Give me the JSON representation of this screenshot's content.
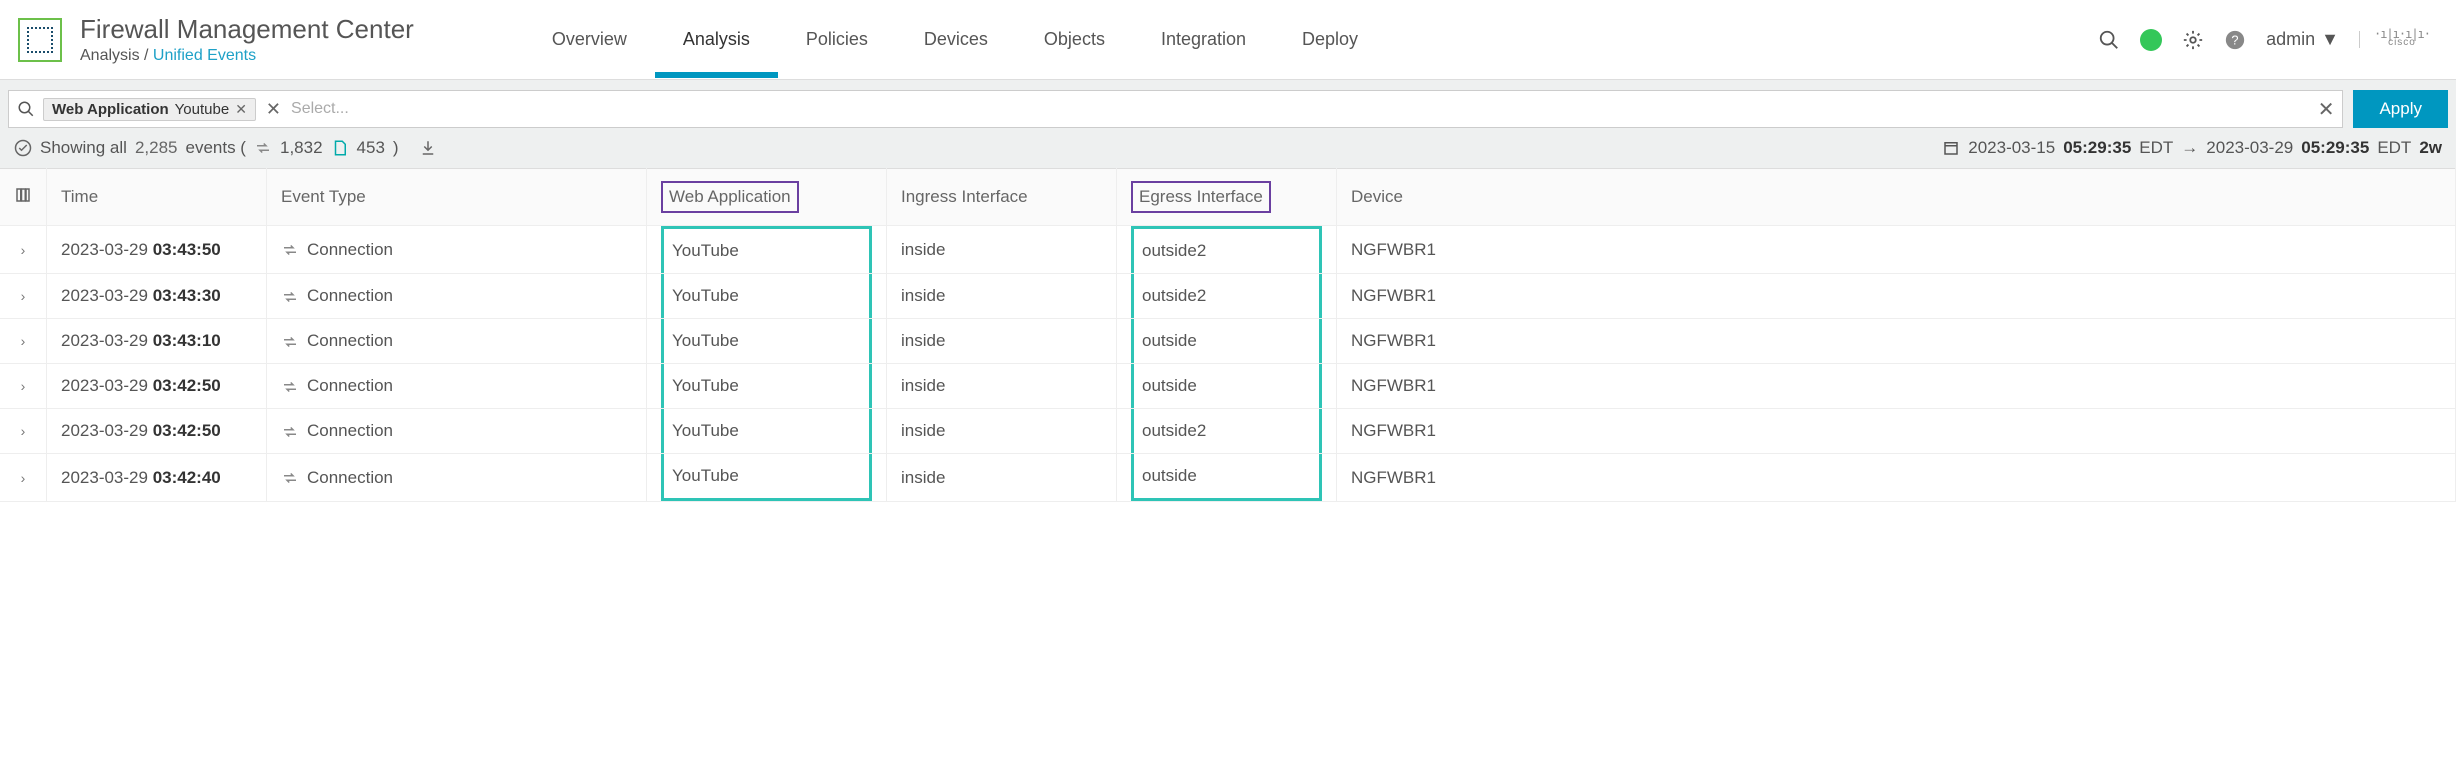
{
  "header": {
    "app_title": "Firewall Management Center",
    "breadcrumb_section": "Analysis",
    "breadcrumb_separator": " / ",
    "breadcrumb_page": "Unified Events",
    "nav": [
      "Overview",
      "Analysis",
      "Policies",
      "Devices",
      "Objects",
      "Integration",
      "Deploy"
    ],
    "active_nav_index": 1,
    "user_label": "admin",
    "vendor": "cisco"
  },
  "filter": {
    "chip_name": "Web Application",
    "chip_value": "Youtube",
    "placeholder": "Select...",
    "apply_label": "Apply"
  },
  "status": {
    "prefix": "Showing all ",
    "total_events": "2,285",
    "events_word": " events (",
    "count_a": "1,832",
    "count_b": "453",
    "close_paren": ")",
    "range_from_date": "2023-03-15 ",
    "range_from_time": "05:29:35",
    "range_from_tz": " EDT",
    "range_arrow": " → ",
    "range_to_date": "2023-03-29 ",
    "range_to_time": "05:29:35",
    "range_to_tz": " EDT ",
    "range_suffix": "2w"
  },
  "table": {
    "columns": {
      "time": "Time",
      "event_type": "Event Type",
      "web_app": "Web Application",
      "ingress": "Ingress Interface",
      "egress": "Egress Interface",
      "device": "Device"
    },
    "rows": [
      {
        "date": "2023-03-29 ",
        "time": "03:43:50",
        "etype": "Connection",
        "webapp": "YouTube",
        "ingress": "inside",
        "egress": "outside2",
        "device": "NGFWBR1"
      },
      {
        "date": "2023-03-29 ",
        "time": "03:43:30",
        "etype": "Connection",
        "webapp": "YouTube",
        "ingress": "inside",
        "egress": "outside2",
        "device": "NGFWBR1"
      },
      {
        "date": "2023-03-29 ",
        "time": "03:43:10",
        "etype": "Connection",
        "webapp": "YouTube",
        "ingress": "inside",
        "egress": "outside",
        "device": "NGFWBR1"
      },
      {
        "date": "2023-03-29 ",
        "time": "03:42:50",
        "etype": "Connection",
        "webapp": "YouTube",
        "ingress": "inside",
        "egress": "outside",
        "device": "NGFWBR1"
      },
      {
        "date": "2023-03-29 ",
        "time": "03:42:50",
        "etype": "Connection",
        "webapp": "YouTube",
        "ingress": "inside",
        "egress": "outside2",
        "device": "NGFWBR1"
      },
      {
        "date": "2023-03-29 ",
        "time": "03:42:40",
        "etype": "Connection",
        "webapp": "YouTube",
        "ingress": "inside",
        "egress": "outside",
        "device": "NGFWBR1"
      }
    ]
  }
}
